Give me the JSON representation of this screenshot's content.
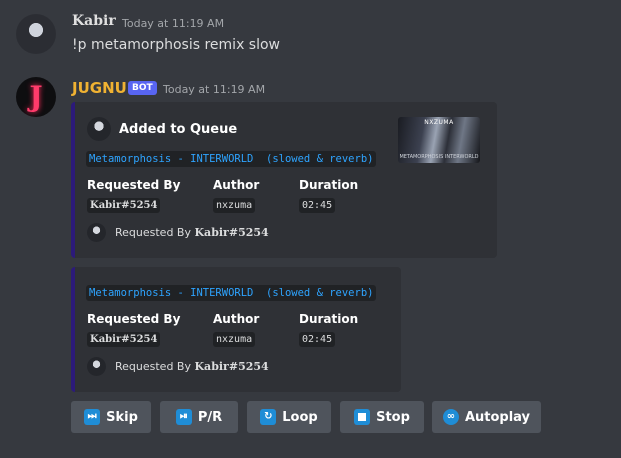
{
  "messages": {
    "user": {
      "name": "Kabir",
      "time": "Today at 11:19 AM",
      "text": "!p metamorphosis remix slow"
    },
    "bot": {
      "name": "JUGNU",
      "badge": "BOT",
      "time": "Today at 11:19 AM",
      "avatar_letter": "J"
    }
  },
  "embed1": {
    "title": "Added to Queue",
    "track": "Metamorphosis - INTERWORLD  (slowed & reverb)",
    "thumbnail": {
      "top_text": "NXZUMA",
      "bottom_text": "METAMORPHOSIS  INTERWORLD"
    },
    "fields": [
      {
        "name": "Requested By",
        "value": "Kabir#5254"
      },
      {
        "name": "Author",
        "value": "nxzuma"
      },
      {
        "name": "Duration",
        "value": "02:45"
      }
    ],
    "footer": {
      "prefix": "Requested By",
      "user": "Kabir#5254"
    }
  },
  "embed2": {
    "track": "Metamorphosis - INTERWORLD  (slowed & reverb)",
    "fields": [
      {
        "name": "Requested By",
        "value": "Kabir#5254"
      },
      {
        "name": "Author",
        "value": "nxzuma"
      },
      {
        "name": "Duration",
        "value": "02:45"
      }
    ],
    "footer": {
      "prefix": "Requested By",
      "user": "Kabir#5254"
    }
  },
  "buttons": [
    {
      "label": "Skip",
      "icon": "skip-icon"
    },
    {
      "label": "P/R",
      "icon": "pause-resume-icon"
    },
    {
      "label": "Loop",
      "icon": "loop-icon"
    },
    {
      "label": "Stop",
      "icon": "stop-icon"
    },
    {
      "label": "Autoplay",
      "icon": "infinity-icon"
    }
  ],
  "colors": {
    "background": "#36393f",
    "embed": "#2f3136",
    "embed_border": "#2c1a7a",
    "bot_name": "#f0b232",
    "badge": "#5865f2",
    "code_text": "#2ea4ff",
    "button": "#4f545c",
    "button_icon": "#1f8dd6"
  }
}
